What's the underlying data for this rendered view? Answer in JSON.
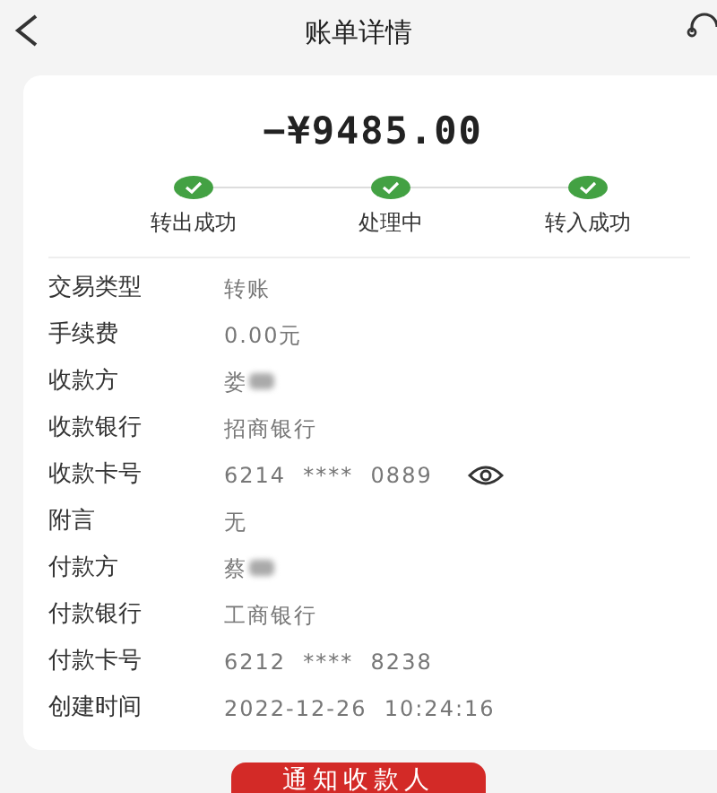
{
  "header": {
    "title": "账单详情"
  },
  "amount": "−¥9485.00",
  "steps": [
    {
      "label": "转出成功",
      "done": true
    },
    {
      "label": "处理中",
      "done": true
    },
    {
      "label": "转入成功",
      "done": true
    }
  ],
  "details": [
    {
      "label": "交易类型",
      "value": "转账"
    },
    {
      "label": "手续费",
      "value": "0.00元"
    },
    {
      "label": "收款方",
      "value": "娄",
      "redacted": true
    },
    {
      "label": "收款银行",
      "value": "招商银行"
    },
    {
      "label": "收款卡号",
      "value": "6214  ****  0889",
      "masked": true
    },
    {
      "label": "附言",
      "value": "无"
    },
    {
      "label": "付款方",
      "value": "蔡",
      "redacted": true
    },
    {
      "label": "付款银行",
      "value": "工商银行"
    },
    {
      "label": "付款卡号",
      "value": "6212  ****  8238"
    },
    {
      "label": "创建时间",
      "value": "2022-12-26  10:24:16"
    }
  ],
  "button": "通知收款人"
}
